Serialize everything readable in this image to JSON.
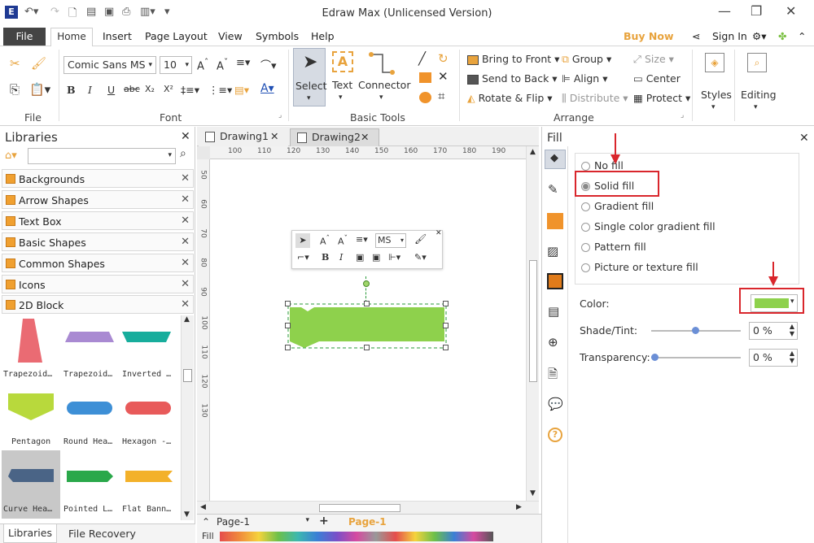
{
  "window": {
    "title": "Edraw Max (Unlicensed Version)"
  },
  "menu": {
    "tabs": [
      "File",
      "Home",
      "Insert",
      "Page Layout",
      "View",
      "Symbols",
      "Help"
    ],
    "buy_now": "Buy Now",
    "sign_in": "Sign In"
  },
  "ribbon": {
    "file_group": "File",
    "font_group": "Font",
    "font_name": "Comic Sans MS",
    "font_size": "10",
    "basic_tools_group": "Basic Tools",
    "select": "Select",
    "text": "Text",
    "connector": "Connector",
    "arrange_group": "Arrange",
    "bring_to_front": "Bring to Front",
    "send_to_back": "Send to Back",
    "rotate_flip": "Rotate & Flip",
    "group": "Group",
    "align": "Align",
    "distribute": "Distribute",
    "size": "Size",
    "center": "Center",
    "protect": "Protect",
    "styles": "Styles",
    "editing": "Editing"
  },
  "libraries": {
    "title": "Libraries",
    "items": [
      "Backgrounds",
      "Arrow Shapes",
      "Text Box",
      "Basic Shapes",
      "Common Shapes",
      "Icons",
      "2D Block"
    ],
    "shapes": [
      "Trapezoid…",
      "Trapezoid…",
      "Inverted …",
      "Pentagon",
      "Round Hea…",
      "Hexagon -…",
      "Curve Hea…",
      "Pointed L…",
      "Flat Bann…"
    ],
    "bottom_tabs": [
      "Libraries",
      "File Recovery"
    ]
  },
  "documents": {
    "tabs": [
      "Drawing1",
      "Drawing2"
    ],
    "ruler_top": [
      "100",
      "110",
      "120",
      "130",
      "140",
      "150",
      "160",
      "170",
      "180",
      "190"
    ],
    "ruler_left": [
      "50",
      "60",
      "70",
      "80",
      "90",
      "100",
      "110",
      "120",
      "130"
    ],
    "page_select": "Page-1",
    "page_tab": "Page-1",
    "fill_label": "Fill",
    "mini_toolbar_font": "MS"
  },
  "fill_panel": {
    "title": "Fill",
    "options": [
      "No fill",
      "Solid fill",
      "Gradient fill",
      "Single color gradient fill",
      "Pattern fill",
      "Picture or texture fill"
    ],
    "selected": "Solid fill",
    "color_label": "Color:",
    "color_value": "#8ed14c",
    "shade_label": "Shade/Tint:",
    "shade_value": "0 %",
    "transparency_label": "Transparency:",
    "transparency_value": "0 %"
  },
  "colors": {
    "accent_orange": "#e8a33d",
    "annotation_red": "#d9262c",
    "shape_green": "#8ed14c"
  }
}
